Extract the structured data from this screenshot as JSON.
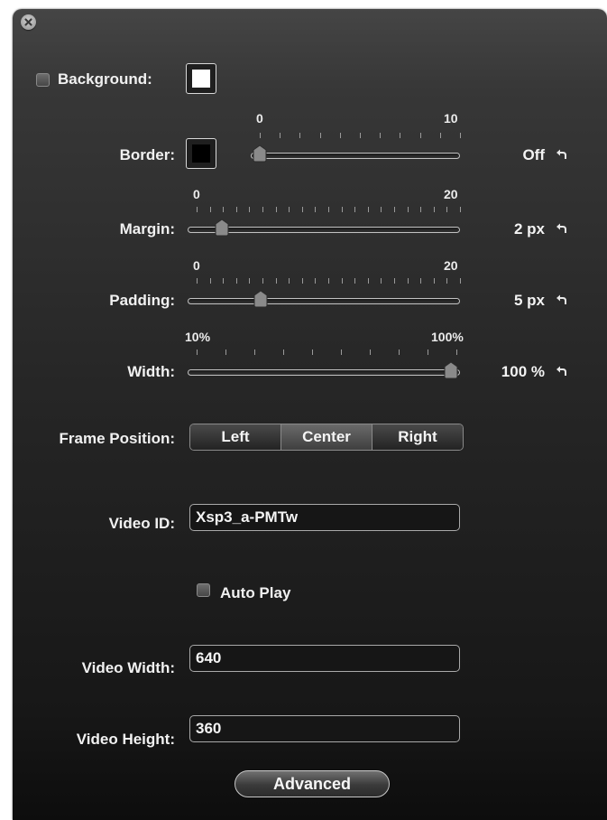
{
  "background": {
    "label": "Background:",
    "checked": false,
    "color": "#ffffff"
  },
  "border": {
    "label": "Border:",
    "color": "#000000",
    "min_label": "0",
    "max_label": "10",
    "min": 0,
    "max": 10,
    "value": 0,
    "value_text": "Off"
  },
  "margin": {
    "label": "Margin:",
    "min_label": "0",
    "max_label": "20",
    "min": 0,
    "max": 20,
    "value": 2,
    "value_text": "2 px"
  },
  "padding": {
    "label": "Padding:",
    "min_label": "0",
    "max_label": "20",
    "min": 0,
    "max": 20,
    "value": 5,
    "value_text": "5 px"
  },
  "width": {
    "label": "Width:",
    "min_label": "10%",
    "max_label": "100%",
    "min": 10,
    "max": 100,
    "value": 100,
    "value_text": "100 %"
  },
  "frame_position": {
    "label": "Frame Position:",
    "options": [
      "Left",
      "Center",
      "Right"
    ],
    "selected": "Center"
  },
  "video_id": {
    "label": "Video ID:",
    "value": "Xsp3_a-PMTw"
  },
  "auto_play": {
    "label": "Auto Play",
    "checked": false
  },
  "video_width": {
    "label": "Video Width:",
    "value": "640"
  },
  "video_height": {
    "label": "Video Height:",
    "value": "360"
  },
  "advanced": {
    "label": "Advanced"
  },
  "icons": {
    "close": "close-icon",
    "reset": "reset-arrow-icon",
    "thumb": "slider-thumb"
  }
}
